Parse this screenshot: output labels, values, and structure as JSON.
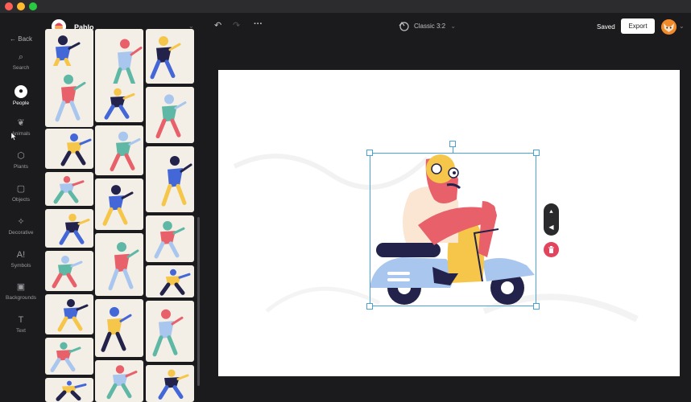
{
  "window": {
    "traffic_colors": [
      "#ff5f57",
      "#febc2e",
      "#28c840"
    ]
  },
  "sidebar": {
    "back_label": "Back",
    "items": [
      {
        "label": "Search",
        "icon": "search-icon",
        "glyph": "⌕"
      },
      {
        "label": "People",
        "icon": "person-icon",
        "glyph": "●",
        "active": true
      },
      {
        "label": "Animals",
        "icon": "paw-icon",
        "glyph": "❦"
      },
      {
        "label": "Plants",
        "icon": "plant-icon",
        "glyph": "⬡"
      },
      {
        "label": "Objects",
        "icon": "objects-icon",
        "glyph": "▢"
      },
      {
        "label": "Decorative",
        "icon": "sparkle-icon",
        "glyph": "✧"
      },
      {
        "label": "Symbols",
        "icon": "symbols-icon",
        "glyph": "A!"
      },
      {
        "label": "Backgrounds",
        "icon": "image-icon",
        "glyph": "▣"
      },
      {
        "label": "Text",
        "icon": "text-icon",
        "glyph": "T"
      }
    ]
  },
  "panel": {
    "title": "Pablo",
    "chevron": "⌄"
  },
  "toolbar": {
    "undo_glyph": "↶",
    "redo_glyph": "↷",
    "more_glyph": "···",
    "canvas_size_label": "Classic  3:2",
    "canvas_size_chevron": "⌄",
    "saved_label": "Saved",
    "export_label": "Export"
  },
  "colors": {
    "accent_selection": "#4aa3d6",
    "delete": "#e2445c",
    "background": "#1b1b1d"
  },
  "selection_tools": {
    "flip_vertical_glyph": "⯅",
    "flip_horizontal_glyph": "◀",
    "delete_glyph": "🗑"
  }
}
